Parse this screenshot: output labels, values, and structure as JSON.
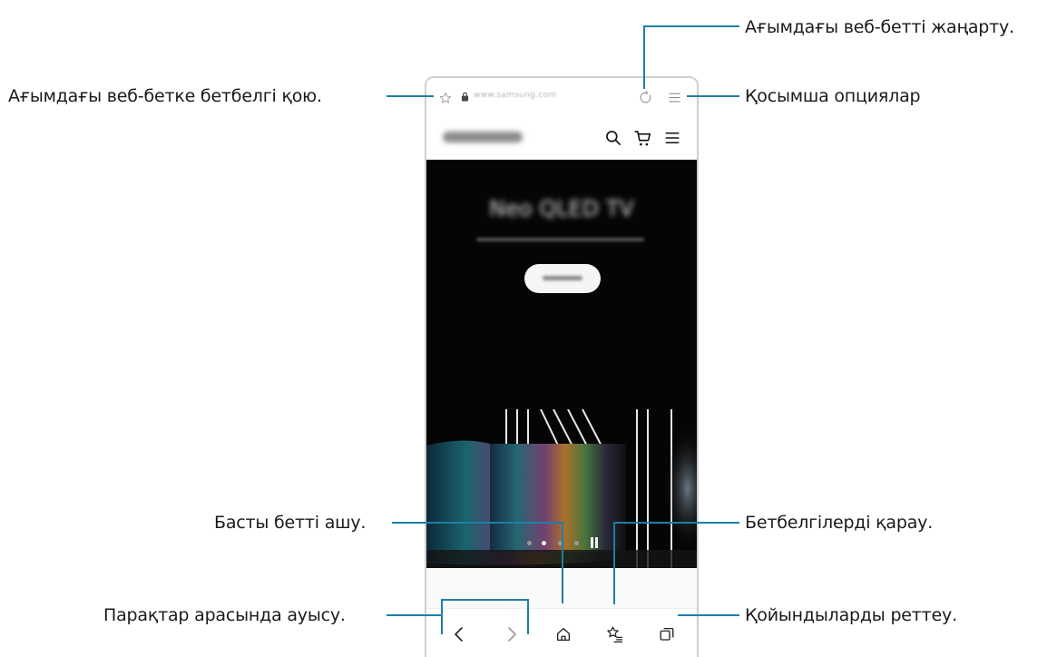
{
  "callouts": {
    "refresh": "Ағымдағы веб-бетті жаңарту.",
    "bookmark_add": "Ағымдағы веб-бетке бетбелгі қою.",
    "more_options": "Қосымша опциялар",
    "home": "Басты бетті ашу.",
    "bookmarks_view": "Бетбелгілерді қарау.",
    "navigate": "Парақтар арасында ауысу.",
    "tabs_manage": "Қойындыларды реттеу."
  },
  "browser": {
    "url": "www.samsung.com",
    "hero_title": "Neo QLED TV"
  },
  "icons": {
    "bookmark_star": "star-outline",
    "lock": "lock",
    "refresh": "refresh",
    "menu": "hamburger",
    "search": "magnifier",
    "cart": "cart",
    "back": "chevron-left",
    "forward": "chevron-right",
    "home": "home",
    "bookmarks": "star-list",
    "tabs": "tabs-stack"
  },
  "colors": {
    "callout_line": "#1d7fa8",
    "hero_background": "#050505"
  }
}
